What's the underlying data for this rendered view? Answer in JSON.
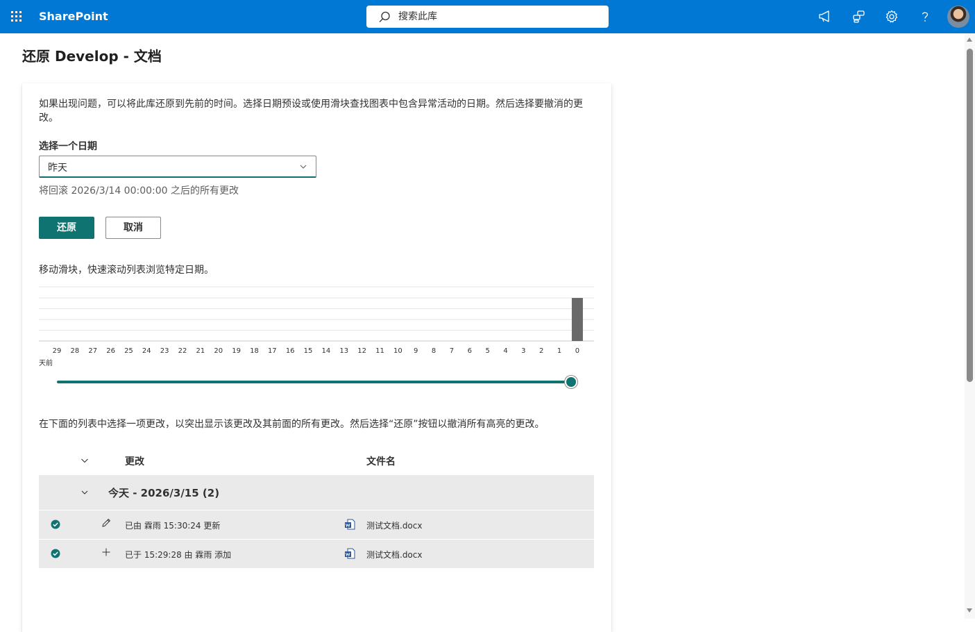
{
  "app": {
    "brand": "SharePoint",
    "accent": "#0078d4",
    "teal": "#0f7471"
  },
  "search": {
    "placeholder": "搜索此库"
  },
  "header_icons": [
    "megaphone-icon",
    "share-icon",
    "gear-icon",
    "help-icon"
  ],
  "page": {
    "title": "还原 Develop - 文档"
  },
  "intro": "如果出现问题，可以将此库还原到先前的时间。选择日期预设或使用滑块查找图表中包含异常活动的日期。然后选择要撤消的更改。",
  "date_picker": {
    "label": "选择一个日期",
    "value": "昨天"
  },
  "rollback_text": "将回滚 2026/3/14 00:00:00 之后的所有更改",
  "buttons": {
    "restore": "还原",
    "cancel": "取消"
  },
  "slider_hint": "移动滑块，快速滚动列表浏览特定日期。",
  "chart_data": {
    "type": "bar",
    "categories": [
      "29",
      "28",
      "27",
      "26",
      "25",
      "24",
      "23",
      "22",
      "21",
      "20",
      "19",
      "18",
      "17",
      "16",
      "15",
      "14",
      "13",
      "12",
      "11",
      "10",
      "9",
      "8",
      "7",
      "6",
      "5",
      "4",
      "3",
      "2",
      "1",
      "0"
    ],
    "values": [
      0,
      0,
      0,
      0,
      0,
      0,
      0,
      0,
      0,
      0,
      0,
      0,
      0,
      0,
      0,
      0,
      0,
      0,
      0,
      0,
      0,
      0,
      0,
      0,
      0,
      0,
      0,
      0,
      0,
      2
    ],
    "xlabel": "天前",
    "ylim": [
      0,
      2
    ],
    "grid": true,
    "bar_color": "#696969"
  },
  "slider": {
    "value_days_ago": 0
  },
  "list_hint": "在下面的列表中选择一项更改，以突出显示该更改及其前面的所有更改。然后选择“还原”按钮以撤消所有高亮的更改。",
  "list": {
    "columns": {
      "change": "更改",
      "file": "文件名"
    },
    "group": {
      "title": "今天 - 2026/3/15 (2)"
    },
    "rows": [
      {
        "icon": "pencil-icon",
        "text": "已由 霖雨 15:30:24 更新",
        "file": "测试文档.docx"
      },
      {
        "icon": "plus-icon",
        "text": "已于 15:29:28 由 霖雨 添加",
        "file": "测试文档.docx"
      }
    ]
  }
}
